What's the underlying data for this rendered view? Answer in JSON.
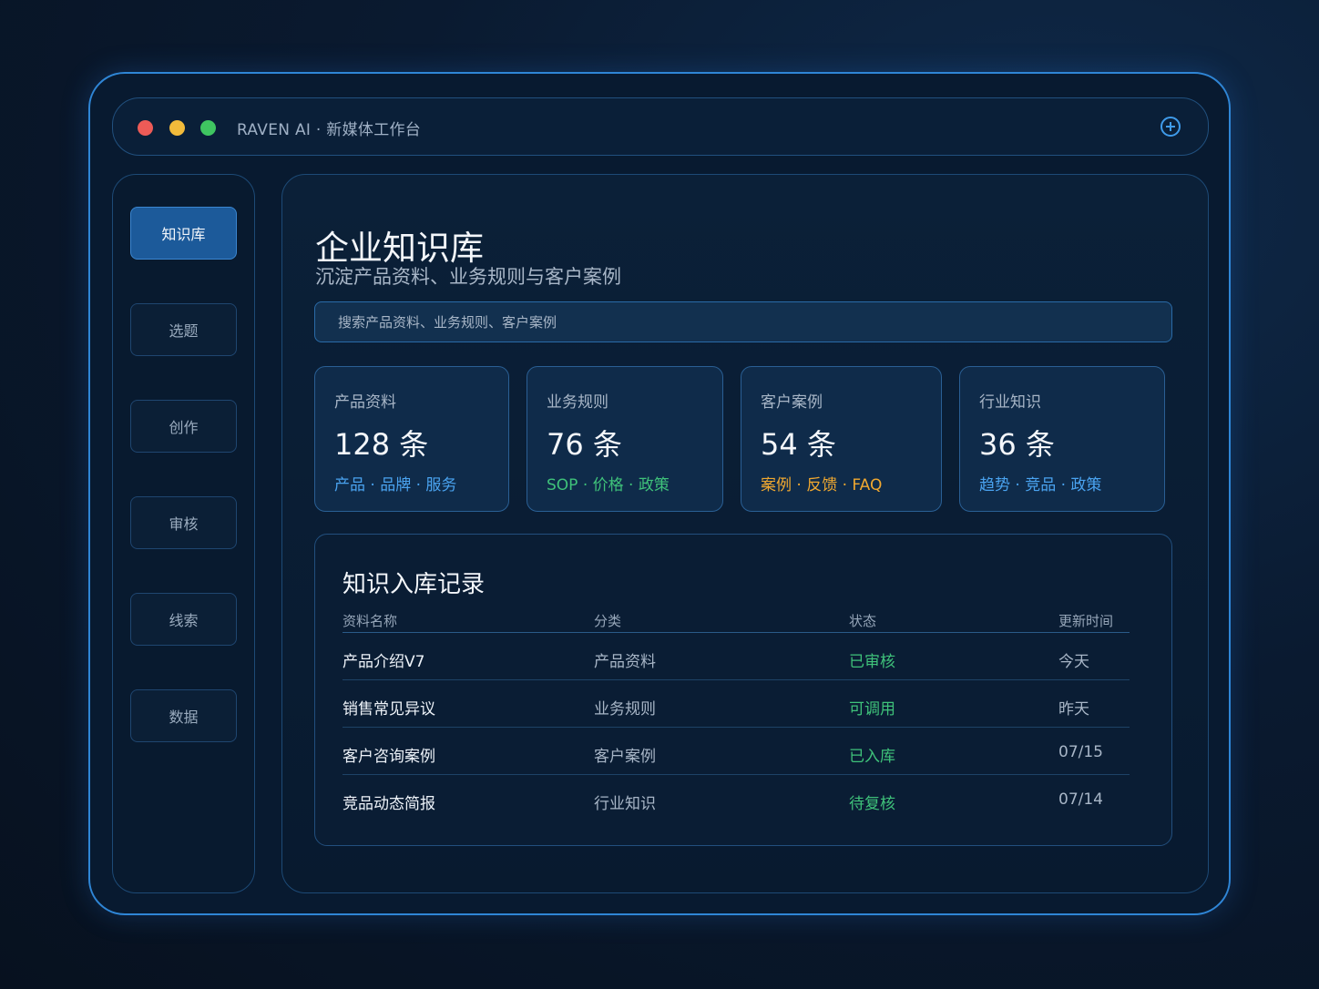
{
  "window": {
    "title": "RAVEN AI · 新媒体工作台"
  },
  "sidebar": {
    "items": [
      {
        "label": "知识库",
        "active": true
      },
      {
        "label": "选题",
        "active": false
      },
      {
        "label": "创作",
        "active": false
      },
      {
        "label": "审核",
        "active": false
      },
      {
        "label": "线索",
        "active": false
      },
      {
        "label": "数据",
        "active": false
      }
    ]
  },
  "main": {
    "title": "企业知识库",
    "subtitle": "沉淀产品资料、业务规则与客户案例",
    "search_placeholder": "搜索产品资料、业务规则、客户案例",
    "cards": [
      {
        "label": "产品资料",
        "value": "128 条",
        "tags": "产品 · 品牌 · 服务",
        "tag_color": "#4aa3f0"
      },
      {
        "label": "业务规则",
        "value": "76 条",
        "tags": "SOP · 价格 · 政策",
        "tag_color": "#3fc27a"
      },
      {
        "label": "客户案例",
        "value": "54 条",
        "tags": "案例 · 反馈 · FAQ",
        "tag_color": "#f0a830"
      },
      {
        "label": "行业知识",
        "value": "36 条",
        "tags": "趋势 · 竞品 · 政策",
        "tag_color": "#4aa3f0"
      }
    ],
    "records": {
      "title": "知识入库记录",
      "headers": [
        "资料名称",
        "分类",
        "状态",
        "更新时间"
      ],
      "rows": [
        {
          "name": "产品介绍V7",
          "category": "产品资料",
          "status": "已审核",
          "time": "今天"
        },
        {
          "name": "销售常见异议",
          "category": "业务规则",
          "status": "可调用",
          "time": "昨天"
        },
        {
          "name": "客户咨询案例",
          "category": "客户案例",
          "status": "已入库",
          "time": "07/15"
        },
        {
          "name": "竞品动态简报",
          "category": "行业知识",
          "status": "待复核",
          "time": "07/14"
        }
      ],
      "status_color": "#3fc27a"
    }
  },
  "colors": {
    "accent": "#2f86d6",
    "active_nav": "#1c5a9a"
  }
}
